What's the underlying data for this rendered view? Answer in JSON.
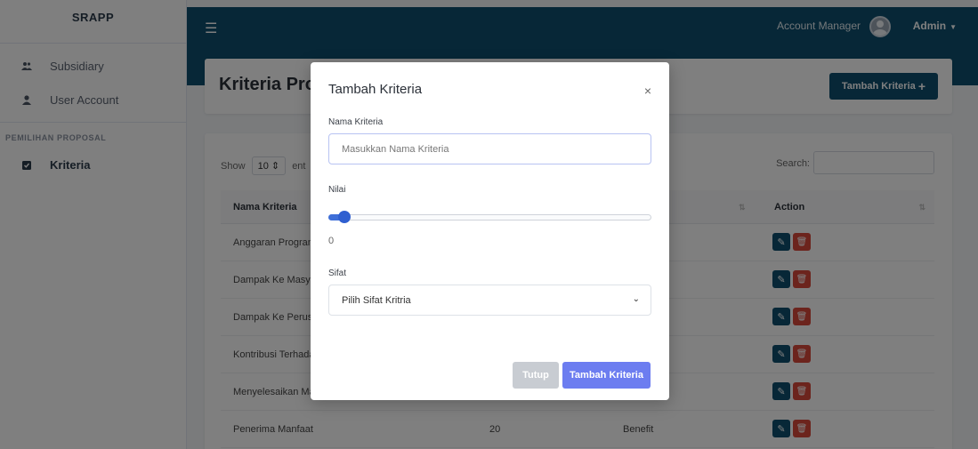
{
  "app": {
    "brand": "SRAPP"
  },
  "sidebar": {
    "items": [
      {
        "label": "Subsidiary",
        "icon": "users-icon"
      },
      {
        "label": "User Account",
        "icon": "user-icon"
      }
    ],
    "heading": "PEMILIHAN PROPOSAL",
    "section_items": [
      {
        "label": "Kriteria",
        "icon": "clipboard-check-icon"
      }
    ]
  },
  "topbar": {
    "account_label": "Account Manager",
    "user_name": "Admin"
  },
  "page": {
    "title": "Kriteria Pro",
    "add_button": "Tambah Kriteria"
  },
  "table": {
    "show_label": "Show",
    "entries_value": "10",
    "entries_suffix": "ent",
    "search_label": "Search:",
    "headers": {
      "name": "Nama Kriteria",
      "action": "Action"
    },
    "rows": [
      {
        "name": "Anggaran Progran",
        "value": "",
        "sifat": ""
      },
      {
        "name": "Dampak Ke Masya",
        "value": "",
        "sifat": ""
      },
      {
        "name": "Dampak Ke Perusa",
        "value": "",
        "sifat": ""
      },
      {
        "name": "Kontribusi Terhada",
        "value": "",
        "sifat": ""
      },
      {
        "name": "Menyelesaikan Ma",
        "value": "",
        "sifat": ""
      },
      {
        "name": "Penerima Manfaat",
        "value": "20",
        "sifat": "Benefit"
      }
    ]
  },
  "modal": {
    "title": "Tambah Kriteria",
    "close_symbol": "×",
    "name_label": "Nama Kriteria",
    "name_placeholder": "Masukkan Nama Kriteria",
    "name_value": "",
    "nilai_label": "Nilai",
    "nilai_value": "0",
    "slider_fraction": 0.0,
    "sifat_label": "Sifat",
    "sifat_selected": "Pilih Sifat Kritria",
    "cancel_button": "Tutup",
    "submit_button": "Tambah Kriteria"
  },
  "colors": {
    "topbar": "#0e4f6e",
    "primary": "#6c7df0",
    "delete": "#d9483b",
    "slider": "#2f5fd0"
  }
}
